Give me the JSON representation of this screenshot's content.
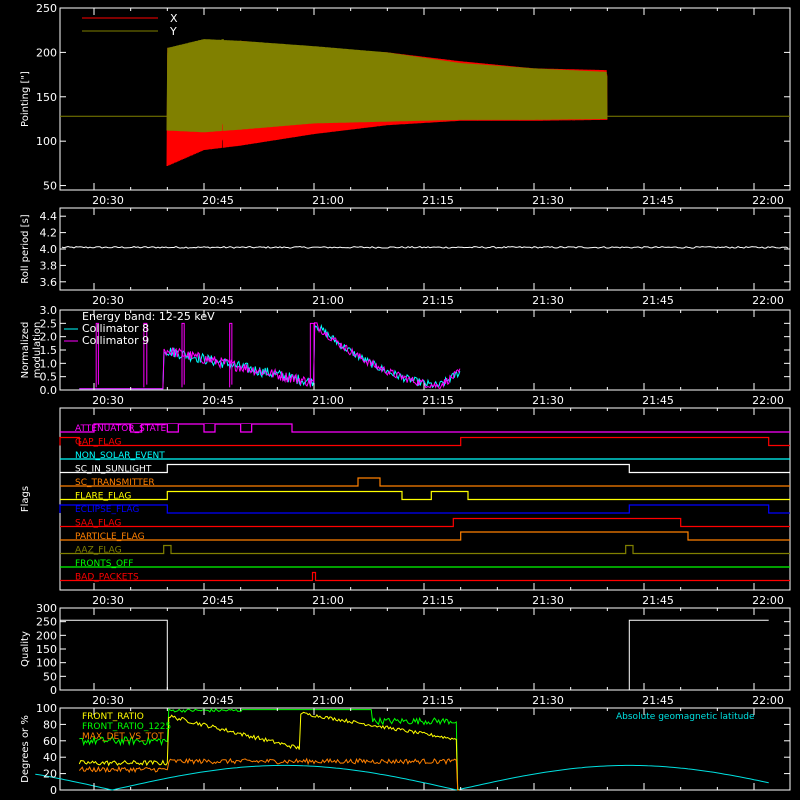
{
  "chart_data": [
    {
      "id": "pointing",
      "type": "line",
      "ylabel": "Pointing [\"]",
      "ylim": [
        45,
        250
      ],
      "yticks": [
        50,
        100,
        150,
        200,
        250
      ],
      "xticks": [
        "20:30",
        "20:45",
        "21:00",
        "21:15",
        "21:30",
        "21:45",
        "22:00"
      ],
      "x_minutes_range": [
        -8,
        92
      ],
      "legend": "top-left",
      "series": [
        {
          "name": "X",
          "color": "#ff0000",
          "baseline": 128,
          "active_from": 10,
          "active_to": 70,
          "envelope_low": [
            [
              10,
              72
            ],
            [
              15,
              90
            ],
            [
              20,
              95
            ],
            [
              30,
              108
            ],
            [
              40,
              118
            ],
            [
              50,
              123
            ],
            [
              60,
              123
            ],
            [
              70,
              124
            ]
          ],
          "envelope_high": [
            [
              10,
              205
            ],
            [
              15,
              210
            ],
            [
              20,
              213
            ],
            [
              30,
              205
            ],
            [
              40,
              200
            ],
            [
              50,
              190
            ],
            [
              60,
              182
            ],
            [
              70,
              180
            ]
          ]
        },
        {
          "name": "Y",
          "color": "#808000",
          "baseline": 128,
          "active_from": 10,
          "active_to": 70,
          "envelope_low": [
            [
              10,
              112
            ],
            [
              15,
              110
            ],
            [
              20,
              113
            ],
            [
              30,
              120
            ],
            [
              40,
              122
            ],
            [
              50,
              124
            ],
            [
              60,
              124
            ],
            [
              70,
              125
            ]
          ],
          "envelope_high": [
            [
              10,
              205
            ],
            [
              15,
              215
            ],
            [
              20,
              213
            ],
            [
              30,
              207
            ],
            [
              40,
              200
            ],
            [
              50,
              188
            ],
            [
              60,
              182
            ],
            [
              70,
              178
            ]
          ]
        }
      ]
    },
    {
      "id": "roll",
      "type": "line",
      "ylabel": "Roll period [s]",
      "ylim": [
        3.5,
        4.5
      ],
      "yticks": [
        3.6,
        3.8,
        4.0,
        4.2,
        4.4
      ],
      "xticks": [
        "20:30",
        "20:45",
        "21:00",
        "21:15",
        "21:30",
        "21:45",
        "22:00"
      ],
      "series": [
        {
          "name": "",
          "color": "#ffffff",
          "value": 4.02
        }
      ]
    },
    {
      "id": "modulation",
      "type": "line",
      "ylabel": "Normalized modulation",
      "ylim": [
        0,
        3.0
      ],
      "yticks": [
        0.0,
        0.5,
        1.0,
        1.5,
        2.0,
        2.5,
        3.0
      ],
      "xticks": [
        "20:30",
        "20:45",
        "21:00",
        "21:15",
        "21:30",
        "21:45",
        "22:00"
      ],
      "legend_title": "Energy band: 12-25 keV",
      "series": [
        {
          "name": "Collimator 8",
          "color": "#00ffff"
        },
        {
          "name": "Collimator 9",
          "color": "#ff00ff"
        }
      ]
    },
    {
      "id": "flags",
      "type": "line",
      "ylabel": "Flags",
      "xticks": [
        "20:30",
        "20:45",
        "21:00",
        "21:15",
        "21:30",
        "21:45",
        "22:00"
      ],
      "flags": [
        {
          "name": "ATTENUATOR_STATE",
          "color": "#ff00ff",
          "on": [
            [
              0,
              27
            ]
          ],
          "notches": [
            5,
            10,
            15,
            20
          ]
        },
        {
          "name": "GAP_FLAG",
          "color": "#ff0000",
          "on": [
            [
              -8,
              -2
            ],
            [
              50,
              92
            ]
          ]
        },
        {
          "name": "NON_SOLAR_EVENT",
          "color": "#00ffff",
          "on": []
        },
        {
          "name": "SC_IN_SUNLIGHT",
          "color": "#ffffff",
          "on": [
            [
              10,
              73
            ]
          ]
        },
        {
          "name": "SC_TRANSMITTER",
          "color": "#ff8000",
          "on": [
            [
              36,
              39
            ]
          ]
        },
        {
          "name": "FLARE_FLAG",
          "color": "#ffff00",
          "on": [
            [
              10,
              42
            ],
            [
              46,
              51
            ]
          ]
        },
        {
          "name": "ECLIPSE_FLAG",
          "color": "#0000ff",
          "on": [
            [
              -8,
              10
            ],
            [
              73,
              92
            ]
          ]
        },
        {
          "name": "SAA_FLAG",
          "color": "#ff0000",
          "on": [
            [
              49,
              80
            ]
          ]
        },
        {
          "name": "PARTICLE_FLAG",
          "color": "#ff8000",
          "on": [
            [
              50,
              81
            ]
          ]
        },
        {
          "name": "AAZ_FLAG",
          "color": "#808000",
          "on": [
            [
              9.5,
              10.5
            ],
            [
              72.5,
              73.5
            ]
          ]
        },
        {
          "name": "FRONTS_OFF",
          "color": "#00ff00",
          "on": []
        },
        {
          "name": "BAD_PACKETS",
          "color": "#ff0000",
          "on": [
            [
              29.8,
              30.2
            ]
          ]
        }
      ]
    },
    {
      "id": "quality",
      "type": "line",
      "ylabel": "Quality",
      "ylim": [
        0,
        300
      ],
      "yticks": [
        0,
        50,
        100,
        150,
        200,
        250,
        300
      ],
      "xticks": [
        "20:30",
        "20:45",
        "21:00",
        "21:15",
        "21:30",
        "21:45",
        "22:00"
      ],
      "series": [
        {
          "name": "",
          "color": "#ffffff",
          "segments": [
            [
              -8,
              10,
              255
            ],
            [
              10,
              73,
              0
            ],
            [
              73,
              92,
              255
            ]
          ]
        }
      ]
    },
    {
      "id": "latitude",
      "type": "line",
      "ylabel": "Degrees or %",
      "ylim": [
        0,
        100
      ],
      "yticks": [
        0,
        20,
        40,
        60,
        80,
        100
      ],
      "annotation": "Absolute geomagnetic latitude",
      "series": [
        {
          "name": "FRONT_RATIO",
          "color": "#ffff00"
        },
        {
          "name": "FRONT_RATIO_1225",
          "color": "#00ff00"
        },
        {
          "name": "MAX_DET_VS_TOT",
          "color": "#ff8000"
        },
        {
          "name": "",
          "color": "#00e0e0"
        }
      ]
    }
  ]
}
